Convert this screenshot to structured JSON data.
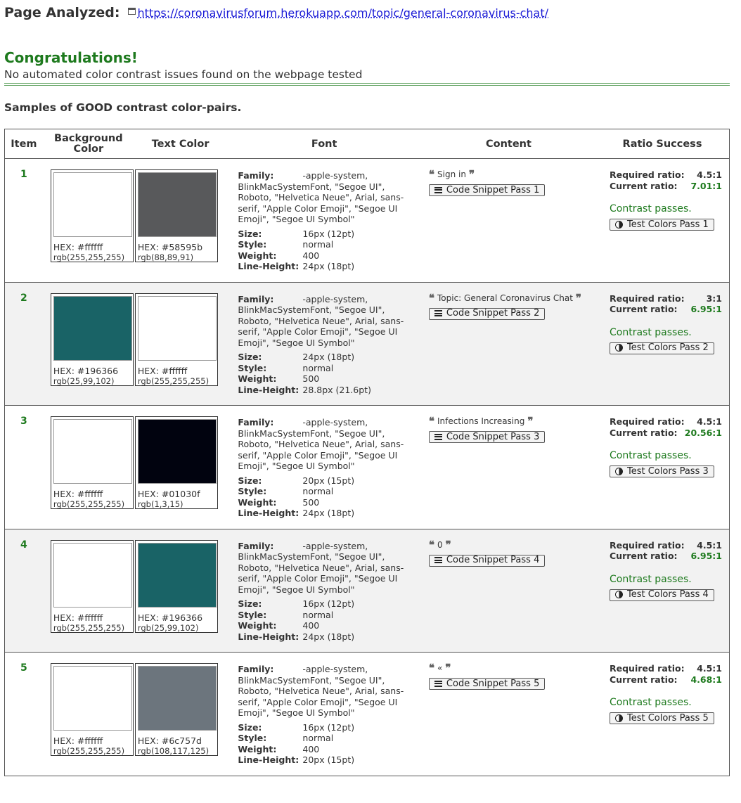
{
  "header": {
    "label": "Page Analyzed:",
    "url": "https://coronavirusforum.herokuapp.com/topic/general-coronavirus-chat/"
  },
  "summary": {
    "title": "Congratulations!",
    "message": "No automated color contrast issues found on the webpage tested"
  },
  "samples_heading": "Samples of GOOD contrast color-pairs.",
  "columns": {
    "item": "Item",
    "background": "Background Color",
    "text_color": "Text Color",
    "font": "Font",
    "content": "Content",
    "ratio": "Ratio Success"
  },
  "labels": {
    "family": "Family:",
    "size": "Size:",
    "style": "Style:",
    "weight": "Weight:",
    "line_height": "Line-Height:",
    "required": "Required ratio:",
    "current": "Current ratio:",
    "passes": "Contrast passes."
  },
  "rows": [
    {
      "item": "1",
      "bg_hex": "HEX: #ffffff",
      "bg_rgb": "rgb(255,255,255)",
      "bg_color": "#ffffff",
      "tc_hex": "HEX: #58595b",
      "tc_rgb": "rgb(88,89,91)",
      "tc_color": "#58595b",
      "family": "-apple-system, BlinkMacSystemFont, \"Segoe UI\", Roboto, \"Helvetica Neue\", Arial, sans-serif, \"Apple Color Emoji\", \"Segoe UI Emoji\", \"Segoe UI Symbol\"",
      "size": "16px (12pt)",
      "style": "normal",
      "weight": "400",
      "line_height": "24px (18pt)",
      "content": "Sign in",
      "snippet_button": "Code Snippet Pass 1",
      "required": "4.5:1",
      "current": "7.01:1",
      "test_button": "Test Colors Pass 1"
    },
    {
      "item": "2",
      "bg_hex": "HEX: #196366",
      "bg_rgb": "rgb(25,99,102)",
      "bg_color": "#196366",
      "tc_hex": "HEX: #ffffff",
      "tc_rgb": "rgb(255,255,255)",
      "tc_color": "#ffffff",
      "family": "-apple-system, BlinkMacSystemFont, \"Segoe UI\", Roboto, \"Helvetica Neue\", Arial, sans-serif, \"Apple Color Emoji\", \"Segoe UI Emoji\", \"Segoe UI Symbol\"",
      "size": "24px (18pt)",
      "style": "normal",
      "weight": "500",
      "line_height": "28.8px (21.6pt)",
      "content": "Topic: General Coronavirus Chat",
      "snippet_button": "Code Snippet Pass 2",
      "required": "3:1",
      "current": "6.95:1",
      "test_button": "Test Colors Pass 2"
    },
    {
      "item": "3",
      "bg_hex": "HEX: #ffffff",
      "bg_rgb": "rgb(255,255,255)",
      "bg_color": "#ffffff",
      "tc_hex": "HEX: #01030f",
      "tc_rgb": "rgb(1,3,15)",
      "tc_color": "#01030f",
      "family": "-apple-system, BlinkMacSystemFont, \"Segoe UI\", Roboto, \"Helvetica Neue\", Arial, sans-serif, \"Apple Color Emoji\", \"Segoe UI Emoji\", \"Segoe UI Symbol\"",
      "size": "20px (15pt)",
      "style": "normal",
      "weight": "500",
      "line_height": "24px (18pt)",
      "content": "Infections Increasing",
      "snippet_button": "Code Snippet Pass 3",
      "required": "4.5:1",
      "current": "20.56:1",
      "test_button": "Test Colors Pass 3"
    },
    {
      "item": "4",
      "bg_hex": "HEX: #ffffff",
      "bg_rgb": "rgb(255,255,255)",
      "bg_color": "#ffffff",
      "tc_hex": "HEX: #196366",
      "tc_rgb": "rgb(25,99,102)",
      "tc_color": "#196366",
      "family": "-apple-system, BlinkMacSystemFont, \"Segoe UI\", Roboto, \"Helvetica Neue\", Arial, sans-serif, \"Apple Color Emoji\", \"Segoe UI Emoji\", \"Segoe UI Symbol\"",
      "size": "16px (12pt)",
      "style": "normal",
      "weight": "400",
      "line_height": "24px (18pt)",
      "content": "0",
      "snippet_button": "Code Snippet Pass 4",
      "required": "4.5:1",
      "current": "6.95:1",
      "test_button": "Test Colors Pass 4"
    },
    {
      "item": "5",
      "bg_hex": "HEX: #ffffff",
      "bg_rgb": "rgb(255,255,255)",
      "bg_color": "#ffffff",
      "tc_hex": "HEX: #6c757d",
      "tc_rgb": "rgb(108,117,125)",
      "tc_color": "#6c757d",
      "family": "-apple-system, BlinkMacSystemFont, \"Segoe UI\", Roboto, \"Helvetica Neue\", Arial, sans-serif, \"Apple Color Emoji\", \"Segoe UI Emoji\", \"Segoe UI Symbol\"",
      "size": "16px (12pt)",
      "style": "normal",
      "weight": "400",
      "line_height": "20px (15pt)",
      "content": "«",
      "snippet_button": "Code Snippet Pass 5",
      "required": "4.5:1",
      "current": "4.68:1",
      "test_button": "Test Colors Pass 5"
    }
  ],
  "colors": {
    "success_green": "#1e7a1e",
    "link_blue": "#1a1ad6",
    "alt_row": "#f2f2f2"
  }
}
